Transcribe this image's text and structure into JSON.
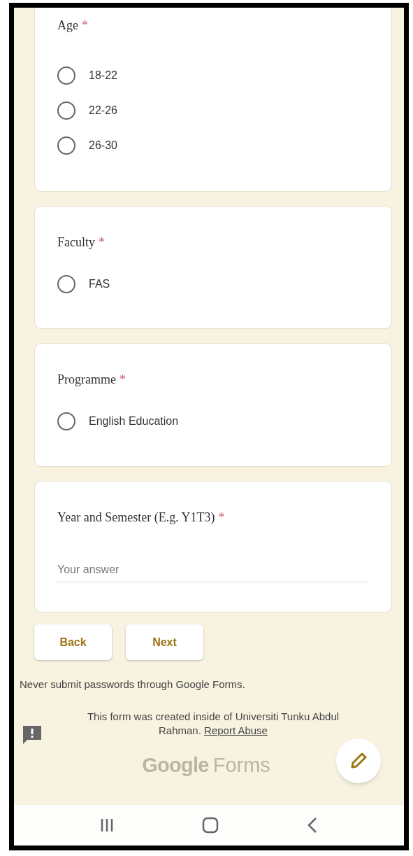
{
  "questions": [
    {
      "kind": "radio",
      "title": "Age",
      "required_mark": "*",
      "options": [
        {
          "label": "18-22",
          "selected": false
        },
        {
          "label": "22-26",
          "selected": false
        },
        {
          "label": "26-30",
          "selected": false
        }
      ]
    },
    {
      "kind": "radio",
      "title": "Faculty",
      "required_mark": "*",
      "options": [
        {
          "label": "FAS",
          "selected": false
        }
      ]
    },
    {
      "kind": "radio",
      "title": "Programme",
      "required_mark": "*",
      "options": [
        {
          "label": "English Education",
          "selected": false
        }
      ]
    },
    {
      "kind": "text",
      "title": "Year and Semester (E.g. Y1T3)",
      "required_mark": "*",
      "placeholder": "Your answer"
    }
  ],
  "buttons": [
    "Back",
    "Next"
  ],
  "footer": {
    "warning": "Never submit passwords through Google Forms.",
    "created_text": "This form was created inside of Universiti Tunku Abdul Rahman.",
    "report_link": "Report Abuse",
    "logo_google": "Google",
    "logo_forms": "Forms"
  }
}
